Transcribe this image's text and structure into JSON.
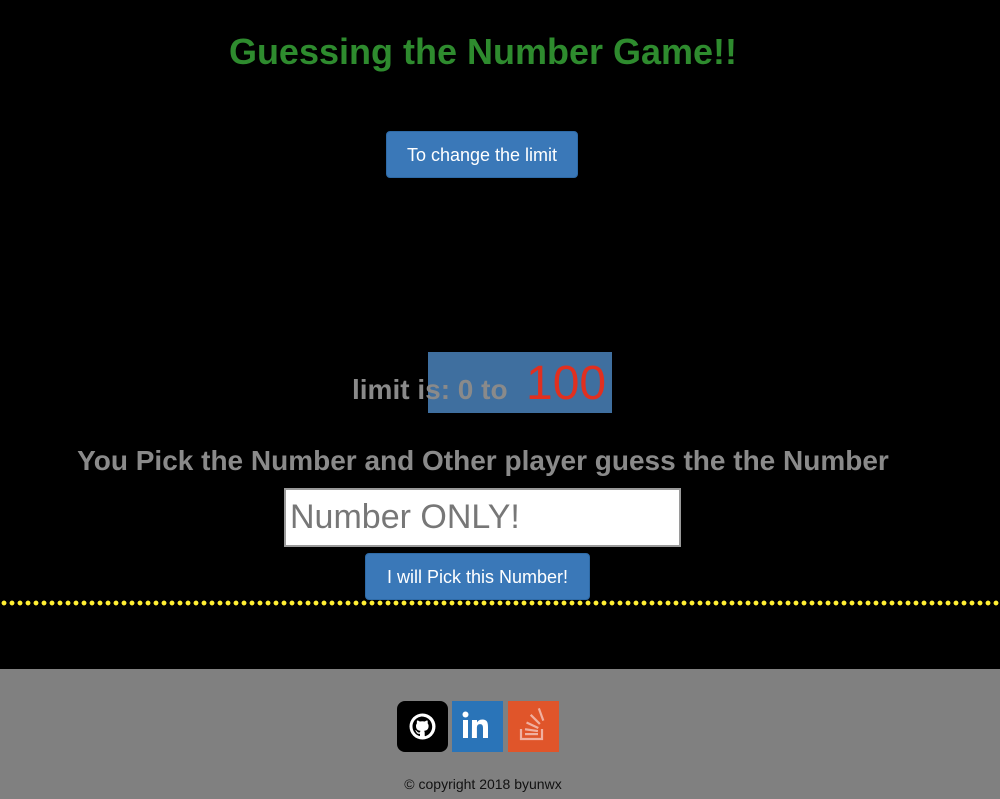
{
  "header": {
    "title": "Guessing the Number Game!!"
  },
  "controls": {
    "change_limit_label": "To change the limit"
  },
  "limit": {
    "label": "limit is: 0 to ",
    "max": "100"
  },
  "instruction": "You Pick the Number and Other player guess the the Number",
  "input": {
    "placeholder": "Number ONLY!",
    "value": ""
  },
  "pick_button_label": "I will Pick this Number!",
  "footer": {
    "social": [
      {
        "name": "github",
        "icon": "github-icon"
      },
      {
        "name": "linkedin",
        "icon": "linkedin-icon"
      },
      {
        "name": "stackoverflow",
        "icon": "stackoverflow-icon"
      }
    ],
    "copyright": "© copyright 2018 byunwx"
  },
  "colors": {
    "background": "#000000",
    "title": "#2e8b2e",
    "button": "#3a78b8",
    "limit_max": "#e03020",
    "text_gray": "#8a8a8a",
    "dotted_line": "#ffee33",
    "footer": "#808080"
  }
}
